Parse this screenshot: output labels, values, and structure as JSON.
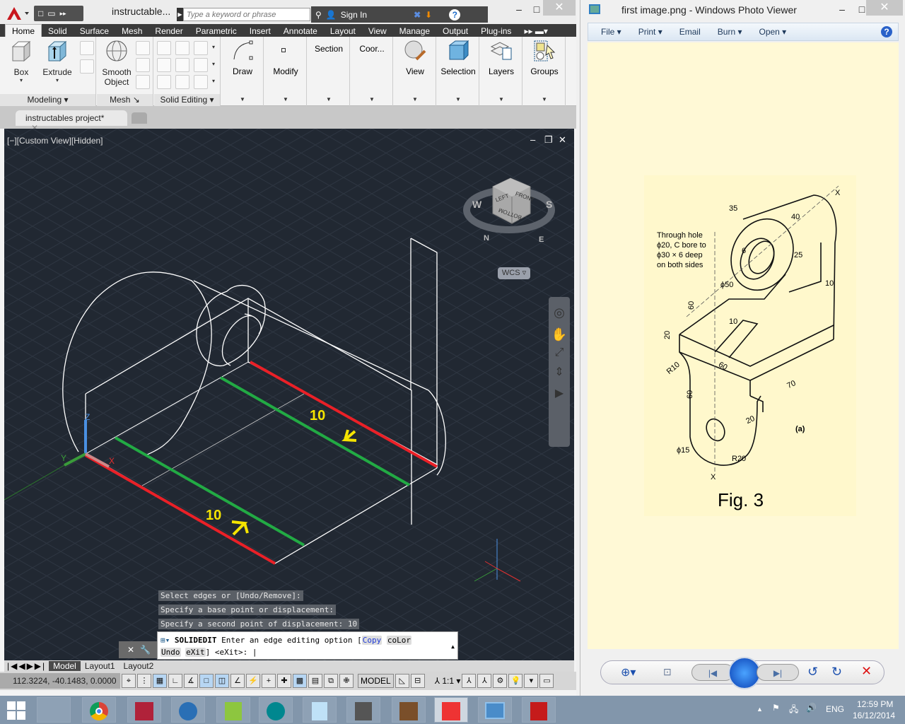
{
  "acad": {
    "doc_title": "instructable...",
    "search_placeholder": "Type a keyword or phrase",
    "sign_in": "Sign In",
    "tabs": [
      "Home",
      "Solid",
      "Surface",
      "Mesh",
      "Render",
      "Parametric",
      "Insert",
      "Annotate",
      "Layout",
      "View",
      "Manage",
      "Output",
      "Plug-ins"
    ],
    "active_tab": "Home",
    "panels": {
      "modeling": {
        "title": "Modeling",
        "buttons": [
          "Box",
          "Extrude"
        ]
      },
      "mesh": {
        "title": "Mesh",
        "button_line1": "Smooth",
        "button_line2": "Object"
      },
      "solid_editing": {
        "title": "Solid Editing"
      },
      "draw": "Draw",
      "modify": "Modify",
      "section": "Section",
      "coordinates": "Coor...",
      "view": "View",
      "selection": "Selection",
      "layers": "Layers",
      "groups": "Groups"
    },
    "document_tab": "instructables project*",
    "viewport_label": "[−][Custom View][Hidden]",
    "viewcube": {
      "faces": [
        "LEFT",
        "FRONT",
        "BOTTOM"
      ],
      "compass": [
        "W",
        "S",
        "N",
        "E"
      ],
      "ucs": "WCS"
    },
    "annotations": [
      {
        "text": "10"
      },
      {
        "text": "10"
      }
    ],
    "axis_labels": {
      "x": "X",
      "y": "Y",
      "z": "Z"
    },
    "command_history": [
      "Select edges or [Undo/Remove]:",
      "Specify a base point or displacement:",
      "Specify a second point of displacement: 10"
    ],
    "command_prompt": {
      "command": "SOLIDEDIT",
      "text": " Enter an edge editing option [",
      "options": [
        "Copy",
        "coLor",
        "Undo",
        "eXit"
      ],
      "suffix": "] <eXit>: "
    },
    "layout_tabs": [
      "Model",
      "Layout1",
      "Layout2"
    ],
    "active_layout": "Model",
    "coordinates": "112.3224, -40.1483, 0.0000",
    "status_model": "MODEL",
    "annotation_scale": "1:1"
  },
  "photo_viewer": {
    "title": "first image.png - Windows Photo Viewer",
    "menu": [
      "File",
      "Print",
      "Email",
      "Burn",
      "Open"
    ],
    "figure_caption": "Fig. 3",
    "drawing_labels": {
      "note": [
        "Through hole",
        "ϕ20, C bore to",
        "ϕ30 × 6 deep",
        "on both sides"
      ],
      "dims": [
        "35",
        "40",
        "25",
        "6",
        "10",
        "ϕ50",
        "60",
        "10",
        "20",
        "R10",
        "60",
        "60",
        "70",
        "20",
        "ϕ15",
        "R20",
        "X",
        "X"
      ],
      "sub": "(a)"
    }
  },
  "taskbar": {
    "apps": [
      "file-explorer",
      "chrome",
      "news-app",
      "thunderbird",
      "openoffice-calc",
      "arduino",
      "notepad",
      "calculator",
      "minecraft",
      "autocad",
      "photo-viewer",
      "acrobat-reader"
    ],
    "language": "ENG",
    "time": "12:59 PM",
    "date": "16/12/2014"
  }
}
